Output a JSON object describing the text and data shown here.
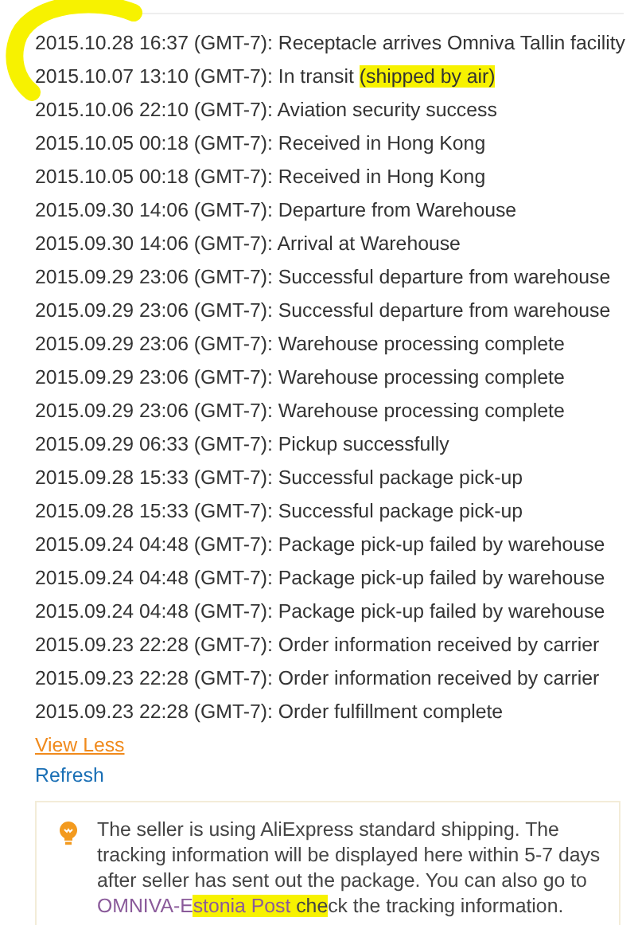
{
  "events": [
    {
      "parts": [
        {
          "text": "2015.10.28 16:37 (GMT-7): Receptacle arrives Omniva Tallin facility",
          "highlighted": false
        }
      ]
    },
    {
      "parts": [
        {
          "text": "2015.10.07 13:10 (GMT-7): In transit ",
          "highlighted": false
        },
        {
          "text": "(shipped by air)",
          "highlighted": true
        }
      ]
    },
    {
      "parts": [
        {
          "text": "2015.10.06 22:10 (GMT-7): Aviation security success",
          "highlighted": false
        }
      ]
    },
    {
      "parts": [
        {
          "text": "2015.10.05 00:18 (GMT-7): Received in Hong Kong",
          "highlighted": false
        }
      ]
    },
    {
      "parts": [
        {
          "text": "2015.10.05 00:18 (GMT-7): Received in Hong Kong",
          "highlighted": false
        }
      ]
    },
    {
      "parts": [
        {
          "text": "2015.09.30 14:06 (GMT-7): Departure from Warehouse",
          "highlighted": false
        }
      ]
    },
    {
      "parts": [
        {
          "text": "2015.09.30 14:06 (GMT-7): Arrival at Warehouse",
          "highlighted": false
        }
      ]
    },
    {
      "parts": [
        {
          "text": "2015.09.29 23:06 (GMT-7): Successful departure from warehouse",
          "highlighted": false
        }
      ]
    },
    {
      "parts": [
        {
          "text": "2015.09.29 23:06 (GMT-7): Successful departure from warehouse",
          "highlighted": false
        }
      ]
    },
    {
      "parts": [
        {
          "text": "2015.09.29 23:06 (GMT-7): Warehouse processing complete",
          "highlighted": false
        }
      ]
    },
    {
      "parts": [
        {
          "text": "2015.09.29 23:06 (GMT-7): Warehouse processing complete",
          "highlighted": false
        }
      ]
    },
    {
      "parts": [
        {
          "text": "2015.09.29 23:06 (GMT-7): Warehouse processing complete",
          "highlighted": false
        }
      ]
    },
    {
      "parts": [
        {
          "text": "2015.09.29 06:33 (GMT-7): Pickup successfully",
          "highlighted": false
        }
      ]
    },
    {
      "parts": [
        {
          "text": "2015.09.28 15:33 (GMT-7): Successful package pick-up",
          "highlighted": false
        }
      ]
    },
    {
      "parts": [
        {
          "text": "2015.09.28 15:33 (GMT-7): Successful package pick-up",
          "highlighted": false
        }
      ]
    },
    {
      "parts": [
        {
          "text": "2015.09.24 04:48 (GMT-7): Package pick-up failed by warehouse",
          "highlighted": false
        }
      ]
    },
    {
      "parts": [
        {
          "text": "2015.09.24 04:48 (GMT-7): Package pick-up failed by warehouse",
          "highlighted": false
        }
      ]
    },
    {
      "parts": [
        {
          "text": "2015.09.24 04:48 (GMT-7): Package pick-up failed by warehouse",
          "highlighted": false
        }
      ]
    },
    {
      "parts": [
        {
          "text": "2015.09.23 22:28 (GMT-7): Order information received by carrier",
          "highlighted": false
        }
      ]
    },
    {
      "parts": [
        {
          "text": "2015.09.23 22:28 (GMT-7): Order information received by carrier",
          "highlighted": false
        }
      ]
    },
    {
      "parts": [
        {
          "text": "2015.09.23 22:28 (GMT-7): Order fulfillment complete",
          "highlighted": false
        }
      ]
    }
  ],
  "view_less_link": "View Less",
  "refresh_link": "Refresh",
  "notice": {
    "parts": [
      {
        "kind": "text",
        "highlighted": false,
        "text": "The seller is using AliExpress standard shipping. The tracking information will be displayed here within 5-7 days after seller has sent out the package. You can also go to "
      },
      {
        "kind": "link",
        "segments": [
          {
            "text": "OMNIVA-E",
            "highlighted": false
          },
          {
            "text": "stonia Post",
            "highlighted": true
          }
        ]
      },
      {
        "kind": "text",
        "highlighted": true,
        "text": " che"
      },
      {
        "kind": "text",
        "highlighted": false,
        "text": "ck the tracking information."
      }
    ]
  }
}
